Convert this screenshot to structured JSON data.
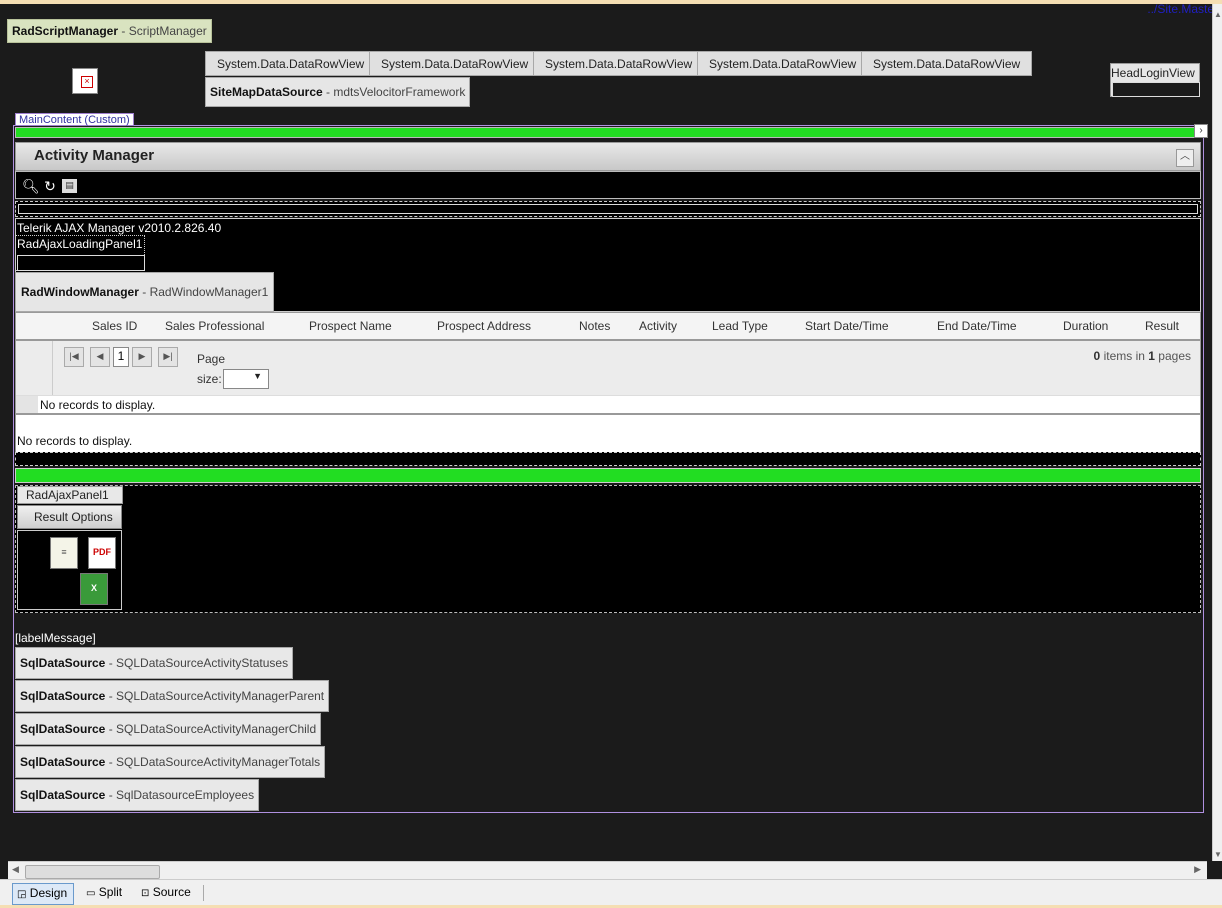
{
  "site_master": "../Site.Master",
  "script_manager": {
    "type": "RadScriptManager",
    "name": "ScriptManager"
  },
  "menu_items": [
    "System.Data.DataRowView",
    "System.Data.DataRowView",
    "System.Data.DataRowView",
    "System.Data.DataRowView",
    "System.Data.DataRowView"
  ],
  "sitemap": {
    "type": "SiteMapDataSource",
    "name": "mdtsVelocitorFramework"
  },
  "head_login": "HeadLoginView",
  "main_content_tab": "MainContent (Custom)",
  "activity_manager": {
    "title": "Activity Manager",
    "toolbar_icons": [
      "search-icon",
      "refresh-icon",
      "export-icon"
    ]
  },
  "ajax_manager_label": "Telerik AJAX Manager v2010.2.826.40",
  "loading_panel_label": "RadAjaxLoadingPanel1",
  "window_manager": {
    "type": "RadWindowManager",
    "name": "RadWindowManager1"
  },
  "grid": {
    "columns": [
      "Sales ID",
      "Sales Professional",
      "Prospect Name",
      "Prospect Address",
      "Notes",
      "Activity",
      "Lead Type",
      "Start Date/Time",
      "End Date/Time",
      "Duration",
      "Result"
    ],
    "pager": {
      "current_page": "1",
      "page_size_label_1": "Page",
      "page_size_label_2": "size:",
      "items_count": "0",
      "items_in": "items in",
      "pages_count": "1",
      "pages_word": "pages"
    },
    "no_records": "No records to display.",
    "no_records_2": "No records to display."
  },
  "ajax_panel_label": "RadAjaxPanel1",
  "result_options_label": "Result Options",
  "export_icons": [
    "word-export-icon",
    "pdf-export-icon",
    "excel-export-icon"
  ],
  "label_message": "[labelMessage]",
  "sql_datasources": [
    {
      "type": "SqlDataSource",
      "name": "SQLDataSourceActivityStatuses"
    },
    {
      "type": "SqlDataSource",
      "name": "SQLDataSourceActivityManagerParent"
    },
    {
      "type": "SqlDataSource",
      "name": "SQLDataSourceActivityManagerChild"
    },
    {
      "type": "SqlDataSource",
      "name": "SQLDataSourceActivityManagerTotals"
    },
    {
      "type": "SqlDataSource",
      "name": "SqlDatasourceEmployees"
    }
  ],
  "view_tabs": [
    {
      "label": "Design",
      "active": true
    },
    {
      "label": "Split",
      "active": false
    },
    {
      "label": "Source",
      "active": false
    }
  ],
  "colors": {
    "accent_green": "#22dd22",
    "design_bg": "#1b1b1b",
    "main_border": "#b090e0"
  }
}
